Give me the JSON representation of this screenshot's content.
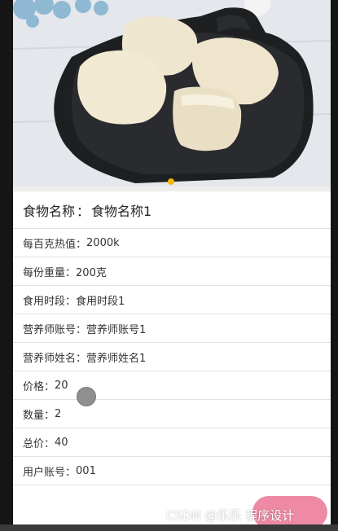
{
  "detail": {
    "title": {
      "label": "食物名称",
      "value": "食物名称1"
    },
    "fields": [
      {
        "label": "每百克热值",
        "value": "2000k"
      },
      {
        "label": "每份重量",
        "value": "200克"
      },
      {
        "label": "食用时段",
        "value": "食用时段1"
      },
      {
        "label": "营养师账号",
        "value": "营养师账号1"
      },
      {
        "label": "营养师姓名",
        "value": "营养师姓名1"
      },
      {
        "label": "价格",
        "value": "20"
      },
      {
        "label": "数量",
        "value": "2"
      },
      {
        "label": "总价",
        "value": "40"
      },
      {
        "label": "用户账号",
        "value": "001"
      }
    ],
    "separator": "："
  },
  "banner": {
    "active_dot_color": "#f5b400",
    "indicator_count": 1
  },
  "watermark": "CSDN @乐乐 程序设计",
  "colors": {
    "fab": "#ee8aa5",
    "divider": "#e2e2e2"
  }
}
